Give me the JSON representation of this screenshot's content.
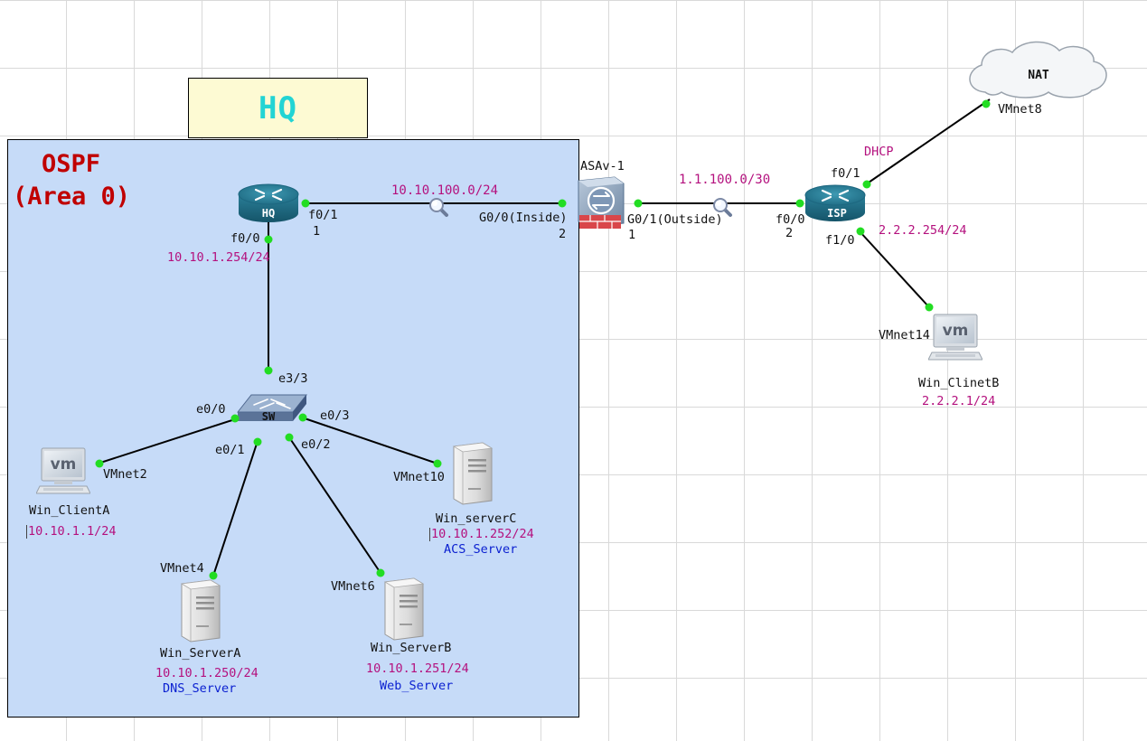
{
  "area": {
    "title": "HQ",
    "protocol": "OSPF",
    "area_name": "(Area 0)"
  },
  "colors": {
    "grid": "#d9d9d9",
    "area_fill": "#c6dbf8",
    "title_fill": "#fdfad3",
    "title_text": "#22d4d4",
    "ospf_text": "#c00000",
    "ip_text": "#b4117e",
    "service_text": "#0a1fd0",
    "port_dot": "#22dd22"
  },
  "nodes": {
    "hq": {
      "name": "HQ",
      "icon": "router-icon"
    },
    "sw": {
      "name": "SW",
      "icon": "switch-icon"
    },
    "asa": {
      "name": "ASAv-1",
      "icon": "firewall-icon"
    },
    "isp": {
      "name": "ISP",
      "icon": "router-icon"
    },
    "nat": {
      "name": "NAT",
      "icon": "cloud-icon"
    },
    "client_a": {
      "name": "Win_ClientA",
      "ip": "10.10.1.1/24",
      "icon": "vm-host-icon"
    },
    "client_b": {
      "name": "Win_ClinetB",
      "ip": "2.2.2.1/24",
      "icon": "vm-host-icon"
    },
    "server_a": {
      "name": "Win_ServerA",
      "ip": "10.10.1.250/24",
      "role": "DNS_Server",
      "icon": "server-icon"
    },
    "server_b": {
      "name": "Win_ServerB",
      "ip": "10.10.1.251/24",
      "role": "Web_Server",
      "icon": "server-icon"
    },
    "server_c": {
      "name": "Win_serverC",
      "ip": "10.10.1.252/24",
      "role": "ACS_Server",
      "icon": "server-icon"
    }
  },
  "ports": {
    "hq_f01": "f0/1",
    "hq_f01_num": "1",
    "hq_f00": "f0/0",
    "hq_f00_ip": "10.10.1.254/24",
    "sw_e33": "e3/3",
    "sw_e00": "e0/0",
    "sw_e01": "e0/1",
    "sw_e02": "e0/2",
    "sw_e03": "e0/3",
    "asa_inside": "G0/0(Inside)",
    "asa_inside_num": "2",
    "asa_outside": "G0/1(Outside)",
    "asa_outside_num": "1",
    "isp_f00": "f0/0",
    "isp_f00_num": "2",
    "isp_f01": "f0/1",
    "isp_f01_dhcp": "DHCP",
    "isp_f10": "f1/0",
    "isp_f10_ip": "2.2.2.254/24",
    "vmnet2": "VMnet2",
    "vmnet4": "VMnet4",
    "vmnet6": "VMnet6",
    "vmnet10": "VMnet10",
    "vmnet8": "VMnet8",
    "vmnet14": "VMnet14"
  },
  "links": {
    "hq_asa_net": "10.10.100.0/24",
    "asa_isp_net": "1.1.100.0/30"
  }
}
